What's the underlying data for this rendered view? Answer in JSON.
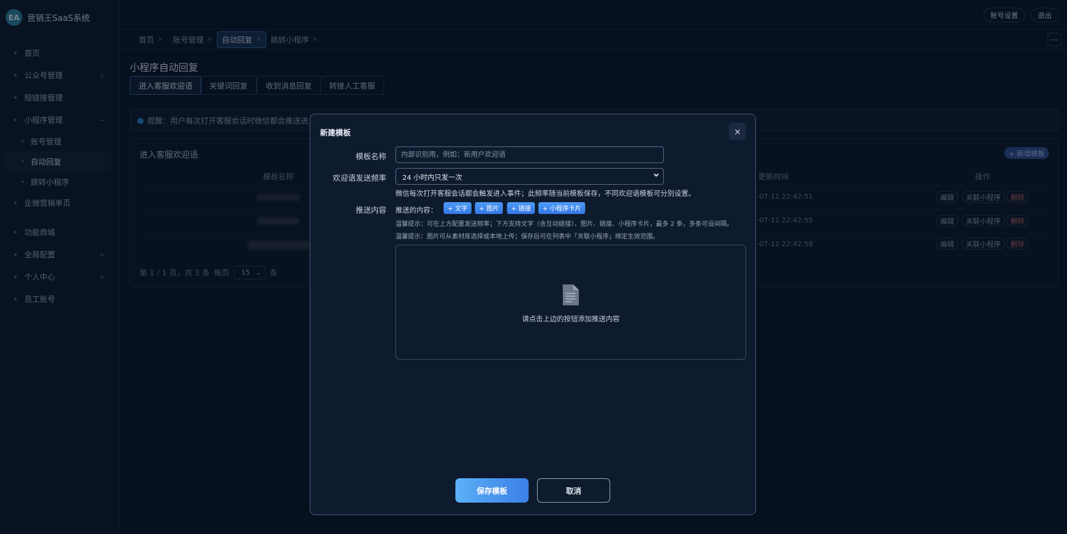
{
  "app": {
    "logo_text": "EA",
    "brand": "营销王SaaS系统"
  },
  "sidebar": {
    "items": [
      {
        "label": "首页"
      },
      {
        "label": "公众号管理",
        "expand": "+"
      },
      {
        "label": "短链接管理"
      },
      {
        "label": "小程序管理",
        "expand": "−"
      },
      {
        "label": "账号管理"
      },
      {
        "label": "自动回复"
      },
      {
        "label": "跳转小程序"
      },
      {
        "label": "企微营销单页"
      },
      {
        "label": "功能商城"
      },
      {
        "label": "全局配置",
        "expand": "+"
      },
      {
        "label": "个人中心",
        "expand": "+"
      },
      {
        "label": "员工账号"
      }
    ]
  },
  "header": {
    "account_settings": "账号设置",
    "logout": "退出",
    "more": "⋯"
  },
  "tabs": [
    {
      "label": "首页",
      "close": "×"
    },
    {
      "label": "账号管理",
      "close": "×"
    },
    {
      "label": "自动回复",
      "close": "×"
    },
    {
      "label": "跳转小程序",
      "close": "×"
    }
  ],
  "page": {
    "title": "小程序自动回复",
    "sub_tabs": [
      "进入客服欢迎语",
      "关键词回复",
      "收到消息回复",
      "转接人工客服"
    ],
    "notice": "提醒：用户每次打开客服会话时微信都会推送进入事"
  },
  "card": {
    "title": "进入客服欢迎语",
    "new_button": "+ 新增模板",
    "columns": {
      "name": "模板名称",
      "updated": "更新时间",
      "actions": "操作"
    },
    "rows": [
      {
        "updated": "-07-11 22:42:51"
      },
      {
        "updated": "-07-11 22:42:55"
      },
      {
        "updated": "-07-11 22:42:58"
      }
    ],
    "actions": {
      "edit": "编辑",
      "link": "关联小程序",
      "delete": "删除"
    },
    "pager": {
      "summary": "第 1 / 1 页，共 3 条",
      "per_page": "每页",
      "size": "15",
      "unit": "条"
    }
  },
  "modal": {
    "title": "新建模板",
    "close": "×",
    "name_label": "模板名称",
    "name_placeholder": "内部识别用，例如：新用户欢迎语",
    "freq_label": "欢迎语发送频率",
    "freq_value": "24 小时内只发一次",
    "freq_help": "微信每次打开客服会话都会触发进入事件；此频率随当前模板保存，不同欢迎语模板可分别设置。",
    "content_label": "推送内容",
    "push_label": "推送的内容：",
    "add_buttons": [
      "+ 文字",
      "+ 图片",
      "+ 链接",
      "+ 小程序卡片"
    ],
    "tip1": "温馨提示：可在上方配置发送频率；下方支持文字（含互动链接）、图片、链接、小程序卡片，最多 2 条，多条可设间隔。",
    "tip2": "温馨提示：图片可从素材库选择或本地上传；保存后可在列表中「关联小程序」绑定生效范围。",
    "empty_text": "请点击上边的按钮添加推送内容",
    "save": "保存模板",
    "cancel": "取消"
  }
}
